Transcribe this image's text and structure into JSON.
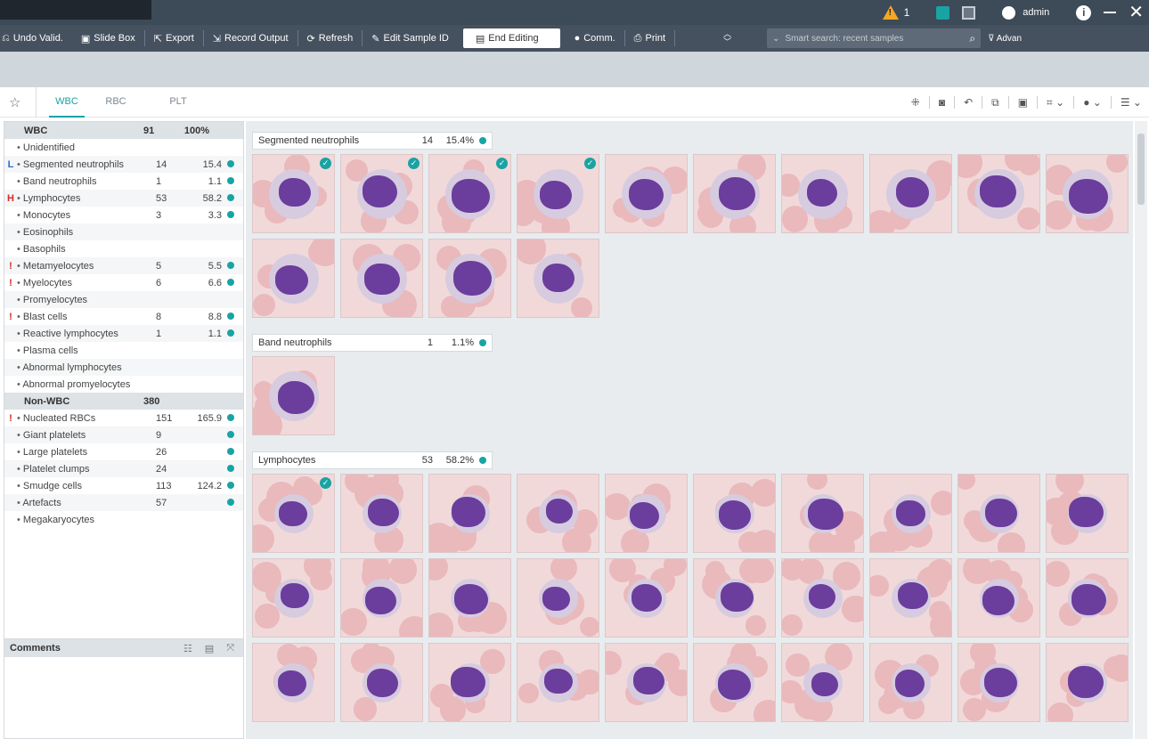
{
  "titlebar": {
    "alert_count": "1",
    "user_name": "admin",
    "icons": [
      "warning-icon",
      "save-icon",
      "calculator-icon",
      "user-icon",
      "info-icon",
      "minimize-icon",
      "close-icon"
    ]
  },
  "toolbar": {
    "undo_valid": "Undo Valid.",
    "slide_box": "Slide Box",
    "export": "Export",
    "record_output": "Record Output",
    "refresh": "Refresh",
    "edit_sample_id": "Edit Sample ID",
    "end_editing": "End Editing",
    "comm": "Comm.",
    "print": "Print",
    "search_placeholder": "Smart search: recent samples",
    "advanced": "Advan"
  },
  "tabs": [
    "WBC",
    "RBC",
    "PLT"
  ],
  "left_panel": {
    "wbc_header": {
      "label": "WBC",
      "count": "91",
      "pct": "100%"
    },
    "wbc_rows": [
      {
        "flag": "",
        "name": "Unidentified",
        "count": "",
        "pct": "",
        "dot": false
      },
      {
        "flag": "L",
        "name": "Segmented neutrophils",
        "count": "14",
        "pct": "15.4",
        "dot": true
      },
      {
        "flag": "",
        "name": "Band neutrophils",
        "count": "1",
        "pct": "1.1",
        "dot": true
      },
      {
        "flag": "H",
        "name": "Lymphocytes",
        "count": "53",
        "pct": "58.2",
        "dot": true
      },
      {
        "flag": "",
        "name": "Monocytes",
        "count": "3",
        "pct": "3.3",
        "dot": true
      },
      {
        "flag": "",
        "name": "Eosinophils",
        "count": "",
        "pct": "",
        "dot": false
      },
      {
        "flag": "",
        "name": "Basophils",
        "count": "",
        "pct": "",
        "dot": false
      },
      {
        "flag": "!",
        "name": "Metamyelocytes",
        "count": "5",
        "pct": "5.5",
        "dot": true
      },
      {
        "flag": "!",
        "name": "Myelocytes",
        "count": "6",
        "pct": "6.6",
        "dot": true
      },
      {
        "flag": "",
        "name": "Promyelocytes",
        "count": "",
        "pct": "",
        "dot": false
      },
      {
        "flag": "!",
        "name": "Blast cells",
        "count": "8",
        "pct": "8.8",
        "dot": true
      },
      {
        "flag": "",
        "name": "Reactive lymphocytes",
        "count": "1",
        "pct": "1.1",
        "dot": true
      },
      {
        "flag": "",
        "name": "Plasma cells",
        "count": "",
        "pct": "",
        "dot": false
      },
      {
        "flag": "",
        "name": "Abnormal lymphocytes",
        "count": "",
        "pct": "",
        "dot": false
      },
      {
        "flag": "",
        "name": "Abnormal promyelocytes",
        "count": "",
        "pct": "",
        "dot": false
      }
    ],
    "nonwbc_header": {
      "label": "Non-WBC",
      "count": "380",
      "pct": ""
    },
    "nonwbc_rows": [
      {
        "flag": "!",
        "name": "Nucleated RBCs",
        "count": "151",
        "pct": "165.9",
        "dot": true
      },
      {
        "flag": "",
        "name": "Giant platelets",
        "count": "9",
        "pct": "",
        "dot": true
      },
      {
        "flag": "",
        "name": "Large platelets",
        "count": "26",
        "pct": "",
        "dot": true
      },
      {
        "flag": "",
        "name": "Platelet clumps",
        "count": "24",
        "pct": "",
        "dot": true
      },
      {
        "flag": "",
        "name": "Smudge cells",
        "count": "113",
        "pct": "124.2",
        "dot": true
      },
      {
        "flag": "",
        "name": "Artefacts",
        "count": "57",
        "pct": "",
        "dot": true
      },
      {
        "flag": "",
        "name": "Megakaryocytes",
        "count": "",
        "pct": "",
        "dot": false
      }
    ],
    "comments_label": "Comments"
  },
  "gallery": [
    {
      "name": "Segmented neutrophils",
      "count": "14",
      "pct": "15.4%",
      "cells": 14,
      "checked": 4,
      "type": "seg"
    },
    {
      "name": "Band neutrophils",
      "count": "1",
      "pct": "1.1%",
      "cells": 1,
      "checked": 0,
      "type": "band"
    },
    {
      "name": "Lymphocytes",
      "count": "53",
      "pct": "58.2%",
      "cells": 30,
      "checked": 1,
      "type": "lym"
    }
  ],
  "colors": {
    "accent": "#1aa3a3",
    "flag_low": "#2a6bd1",
    "flag_high": "#d72a2a",
    "toolbar": "#45515e",
    "nucleus": "#6b3d9c"
  }
}
